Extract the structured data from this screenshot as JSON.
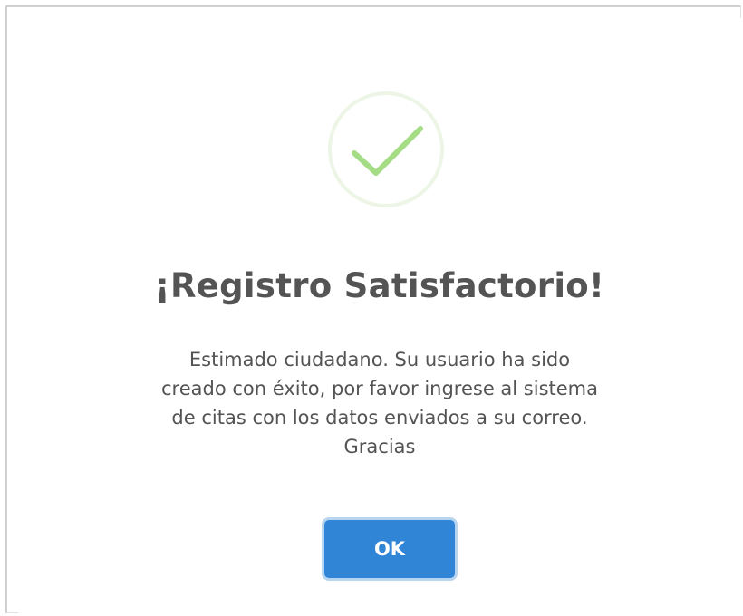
{
  "dialog": {
    "icon": "success-checkmark-icon",
    "title": "¡Registro Satisfactorio!",
    "message_lines": [
      "Estimado ciudadano. Su usuario ha sido",
      "creado con éxito, por favor ingrese al sistema",
      "de citas con los datos enviados a su correo.",
      "Gracias"
    ],
    "confirm_label": "OK"
  },
  "colors": {
    "confirm_button": "#3085d6",
    "success_check": "#a5dc86",
    "success_ring": "#edf6e6",
    "text": "#545454"
  }
}
